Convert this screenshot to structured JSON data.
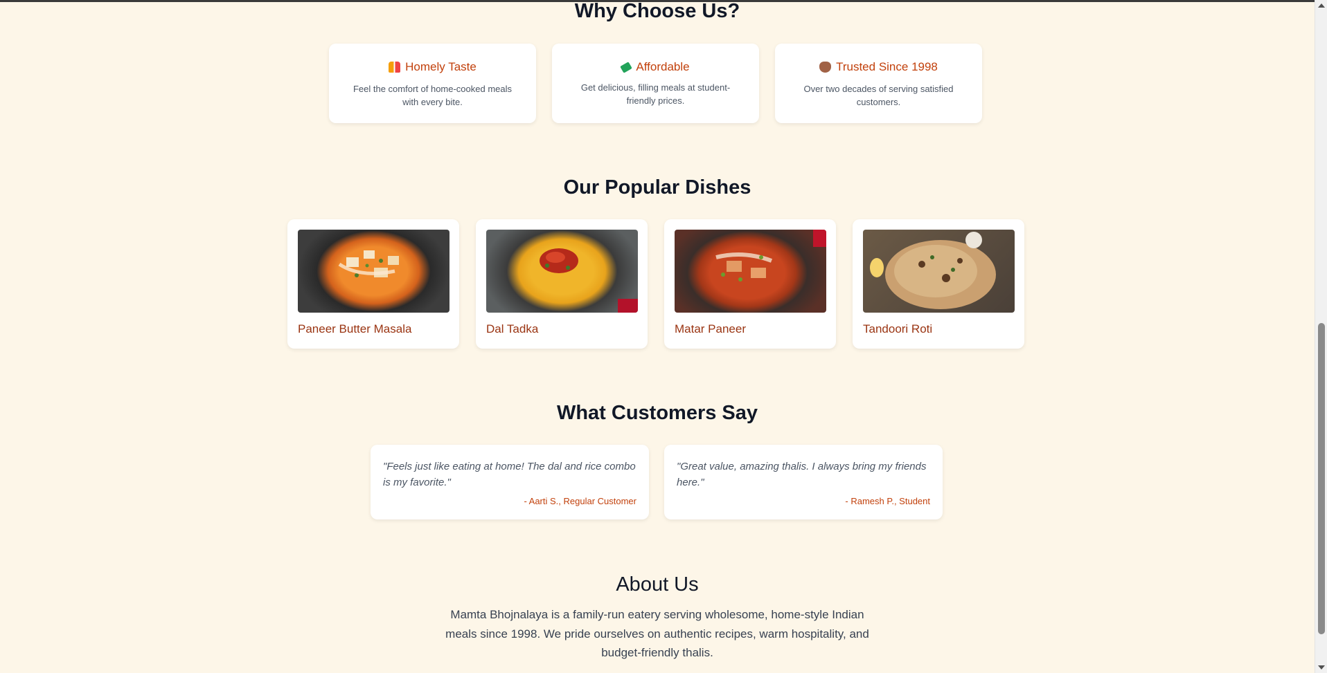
{
  "why": {
    "title": "Why Choose Us?",
    "features": [
      {
        "icon": "people-icon",
        "title": "Homely Taste",
        "desc": "Feel the comfort of home-cooked meals with every bite."
      },
      {
        "icon": "money-icon",
        "title": "Affordable",
        "desc": "Get delicious, filling meals at student-friendly prices."
      },
      {
        "icon": "heart-icon",
        "title": "Trusted Since 1998",
        "desc": "Over two decades of serving satisfied customers."
      }
    ]
  },
  "dishes": {
    "title": "Our Popular Dishes",
    "items": [
      {
        "name": "Paneer Butter Masala"
      },
      {
        "name": "Dal Tadka"
      },
      {
        "name": "Matar Paneer"
      },
      {
        "name": "Tandoori Roti"
      }
    ]
  },
  "reviews": {
    "title": "What Customers Say",
    "items": [
      {
        "text": "\"Feels just like eating at home! The dal and rice combo is my favorite.\"",
        "author": "- Aarti S., Regular Customer"
      },
      {
        "text": "\"Great value, amazing thalis. I always bring my friends here.\"",
        "author": "- Ramesh P., Student"
      }
    ]
  },
  "about": {
    "title": "About Us",
    "text": "Mamta Bhojnalaya is a family-run eatery serving wholesome, home-style Indian meals since 1998. We pride ourselves on authentic recipes, warm hospitality, and budget-friendly thalis."
  },
  "colors": {
    "background": "#fdf6e8",
    "accent": "#c2410c",
    "dish_name": "#9a3412",
    "heading": "#111827"
  }
}
